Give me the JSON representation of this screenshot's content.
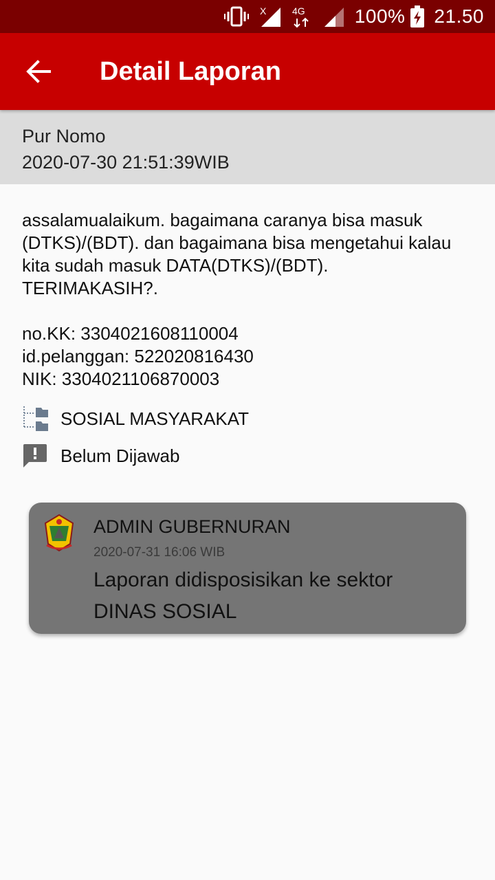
{
  "status_bar": {
    "battery": "100%",
    "time": "21.50",
    "network": "4G",
    "icons": [
      "vibrate-icon",
      "signal-no-service-icon",
      "data-arrows-icon",
      "signal-icon",
      "battery-charging-icon"
    ]
  },
  "app_bar": {
    "title": "Detail Laporan",
    "back_icon": "arrow-left-icon"
  },
  "report": {
    "sender": "Pur Nomo",
    "timestamp": "2020-07-30 21:51:39WIB",
    "message": "assalamualaikum. bagaimana caranya bisa masuk (DTKS)/(BDT). dan bagaimana bisa mengetahui kalau kita sudah masuk DATA(DTKS)/(BDT). TERIMAKASIH?.\n\nno.KK: 3304021608110004\nid.pelanggan: 522020816430\nNIK: 3304021106870003",
    "category": "SOSIAL MASYARAKAT",
    "category_icon": "folder-tree-icon",
    "status": "Belum Dijawab",
    "status_icon": "alert-message-icon"
  },
  "reply": {
    "author": "ADMIN GUBERNURAN",
    "timestamp": "2020-07-31 16:06 WIB",
    "text": "Laporan didisposisikan ke sektor DINAS SOSIAL",
    "logo_icon": "province-emblem-icon"
  },
  "colors": {
    "status_bar": "#7a0000",
    "app_bar": "#c70000",
    "header_bg": "#dcdcdc",
    "card_bg": "#757575"
  }
}
